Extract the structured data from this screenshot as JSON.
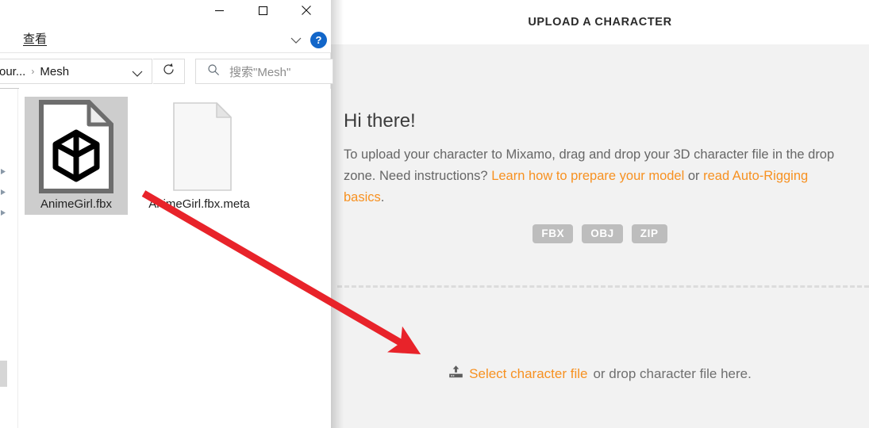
{
  "explorer": {
    "window_controls": {
      "minimize": "minimize-icon",
      "maximize": "maximize-icon",
      "close": "close-icon"
    },
    "ribbon": {
      "view_menu": "查看",
      "expand_icon": "chevron-down-icon",
      "help_label": "?"
    },
    "address": {
      "crumb_truncated": "our...",
      "crumb_separator": "›",
      "crumb_current": "Mesh",
      "dropdown_icon": "chevron-down-icon",
      "refresh_icon": "refresh-icon"
    },
    "search": {
      "icon": "search-icon",
      "placeholder": "搜索\"Mesh\""
    },
    "files": [
      {
        "name": "AnimeGirl.fbx",
        "icon": "fbx-file-icon",
        "selected": true
      },
      {
        "name": "AnimeGirl.fbx.meta",
        "icon": "generic-file-icon",
        "selected": false
      }
    ]
  },
  "mixamo": {
    "header_title": "UPLOAD A CHARACTER",
    "greeting": "Hi there!",
    "intro": {
      "part1": "To upload your character to Mixamo, drag and drop your 3D character file in the drop zone. Need instructions? ",
      "link1": "Learn how to prepare your model",
      "middle": " or ",
      "link2": "read Auto-Rigging basics",
      "end": "."
    },
    "formats": [
      "FBX",
      "OBJ",
      "ZIP"
    ],
    "dropzone": {
      "upload_icon": "upload-icon",
      "select_link": "Select character file",
      "rest_text": " or drop character file here."
    }
  },
  "annotation": {
    "arrow_color": "#e8232a",
    "arrow_from": "AnimeGirl.fbx file icon",
    "arrow_to": "Select character file drop zone"
  },
  "colors": {
    "accent_orange": "#f79121",
    "page_bg": "#f2f2f2",
    "badge_gray": "#bdbdbd",
    "help_blue": "#1266c9",
    "arrow_red": "#e8232a"
  }
}
